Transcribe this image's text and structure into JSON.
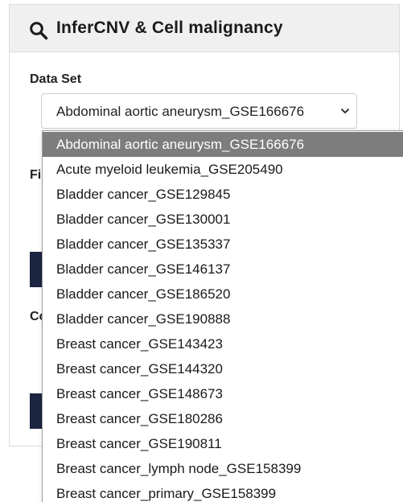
{
  "header": {
    "title": "InferCNV & Cell malignancy",
    "icon": "search-icon"
  },
  "form": {
    "dataset_label": "Data Set",
    "dataset_selected": "Abdominal aortic aneurysm_GSE166676",
    "partial_label_1": "Fi",
    "partial_label_2": "Co"
  },
  "dropdown": {
    "options": [
      "Abdominal aortic aneurysm_GSE166676",
      "Acute myeloid leukemia_GSE205490",
      "Bladder cancer_GSE129845",
      "Bladder cancer_GSE130001",
      "Bladder cancer_GSE135337",
      "Bladder cancer_GSE146137",
      "Bladder cancer_GSE186520",
      "Bladder cancer_GSE190888",
      "Breast cancer_GSE143423",
      "Breast cancer_GSE144320",
      "Breast cancer_GSE148673",
      "Breast cancer_GSE180286",
      "Breast cancer_GSE190811",
      "Breast cancer_lymph node_GSE158399",
      "Breast cancer_primary_GSE158399"
    ],
    "highlight_color": "#7d7d7d"
  },
  "colors": {
    "header_bg": "#f0f0f0",
    "button_bg": "#1c2541"
  }
}
